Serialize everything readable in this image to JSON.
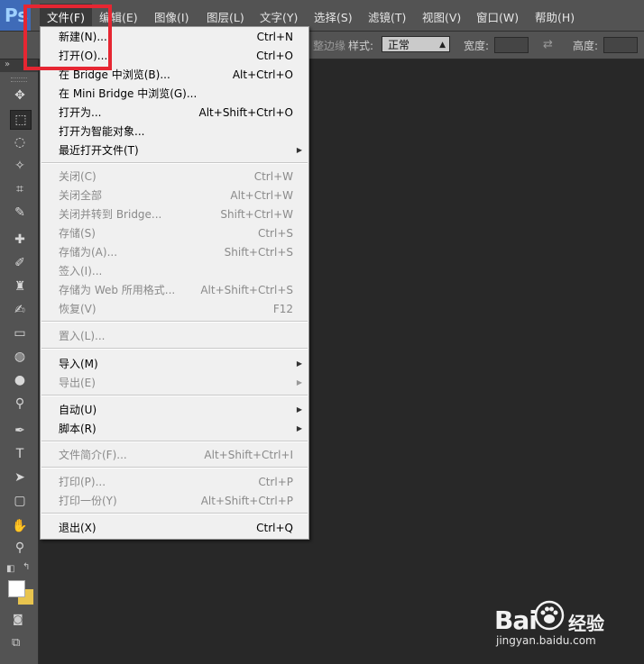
{
  "app": {
    "logo_text": "Ps"
  },
  "menubar": {
    "items": [
      "文件(F)",
      "编辑(E)",
      "图像(I)",
      "图层(L)",
      "文字(Y)",
      "选择(S)",
      "滤镜(T)",
      "视图(V)",
      "窗口(W)",
      "帮助(H)"
    ]
  },
  "options": {
    "partial_label": "调整边缘",
    "style_label": "样式:",
    "style_value": "正常",
    "width_label": "宽度:",
    "height_label": "高度:"
  },
  "file_menu": {
    "new": {
      "label": "新建(N)...",
      "shortcut": "Ctrl+N"
    },
    "open": {
      "label": "打开(O)...",
      "shortcut": "Ctrl+O"
    },
    "browse_bridge": {
      "label": "在 Bridge 中浏览(B)...",
      "shortcut": "Alt+Ctrl+O"
    },
    "browse_mini_bridge": {
      "label": "在 Mini Bridge 中浏览(G)...",
      "shortcut": ""
    },
    "open_as": {
      "label": "打开为...",
      "shortcut": "Alt+Shift+Ctrl+O"
    },
    "open_smart": {
      "label": "打开为智能对象...",
      "shortcut": ""
    },
    "recent": {
      "label": "最近打开文件(T)",
      "shortcut": ""
    },
    "close": {
      "label": "关闭(C)",
      "shortcut": "Ctrl+W"
    },
    "close_all": {
      "label": "关闭全部",
      "shortcut": "Alt+Ctrl+W"
    },
    "close_bridge": {
      "label": "关闭并转到 Bridge...",
      "shortcut": "Shift+Ctrl+W"
    },
    "save": {
      "label": "存储(S)",
      "shortcut": "Ctrl+S"
    },
    "save_as": {
      "label": "存储为(A)...",
      "shortcut": "Shift+Ctrl+S"
    },
    "check_in": {
      "label": "签入(I)...",
      "shortcut": ""
    },
    "save_web": {
      "label": "存储为 Web 所用格式...",
      "shortcut": "Alt+Shift+Ctrl+S"
    },
    "revert": {
      "label": "恢复(V)",
      "shortcut": "F12"
    },
    "place": {
      "label": "置入(L)...",
      "shortcut": ""
    },
    "import": {
      "label": "导入(M)",
      "shortcut": ""
    },
    "export": {
      "label": "导出(E)",
      "shortcut": ""
    },
    "automate": {
      "label": "自动(U)",
      "shortcut": ""
    },
    "scripts": {
      "label": "脚本(R)",
      "shortcut": ""
    },
    "file_info": {
      "label": "文件简介(F)...",
      "shortcut": "Alt+Shift+Ctrl+I"
    },
    "print": {
      "label": "打印(P)...",
      "shortcut": "Ctrl+P"
    },
    "print_one": {
      "label": "打印一份(Y)",
      "shortcut": "Alt+Shift+Ctrl+P"
    },
    "exit": {
      "label": "退出(X)",
      "shortcut": "Ctrl+Q"
    }
  },
  "watermark": {
    "brand": "Bai",
    "brand_cn": "经验",
    "url": "jingyan.baidu.com"
  },
  "colors": {
    "highlight": "#e62632",
    "menubar": "#535353",
    "canvas": "#282828"
  }
}
